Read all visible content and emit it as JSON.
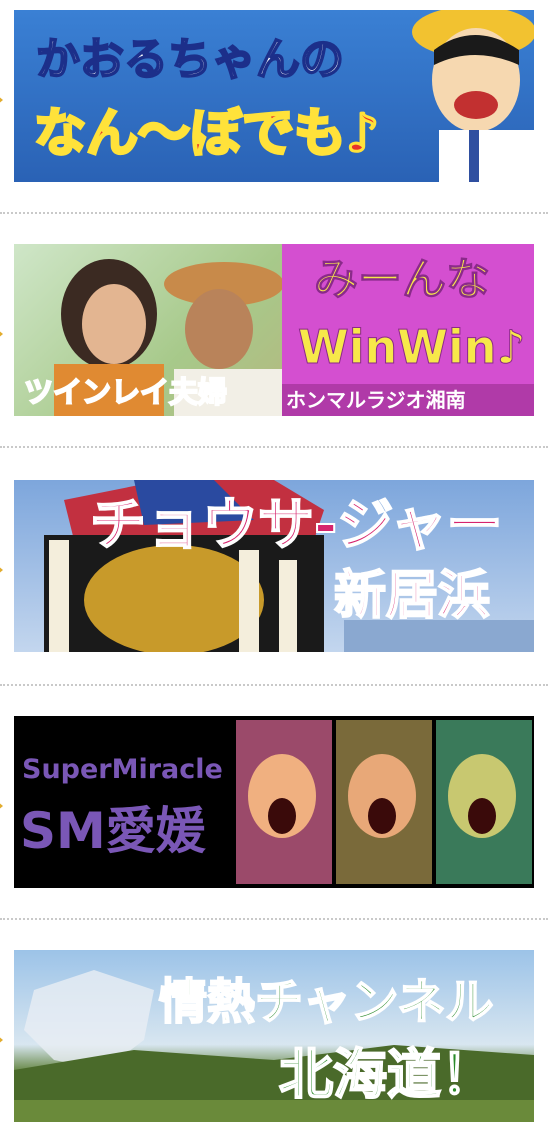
{
  "banners": [
    {
      "lines": [
        "かおるちゃんの",
        "なん〜ぼでも♪"
      ]
    },
    {
      "lines": [
        "みーんな",
        "WinWin♪",
        "ホンマルラジオ湘南",
        "ツインレイ夫婦"
      ]
    },
    {
      "lines": [
        "チョウサ-ジャー",
        "新居浜"
      ]
    },
    {
      "lines": [
        "SuperMiracle",
        "SM愛媛"
      ]
    },
    {
      "lines": [
        "情熱チャンネル",
        "北海道！"
      ]
    }
  ],
  "colors": {
    "arrow": "#e2ad2e",
    "separator": "#c9c9c9",
    "banner1_bg": "#2f6fc2",
    "banner1_title": "#ffffff",
    "banner1_subtitle": "#e8332a",
    "banner2_panel": "#d44fd0",
    "banner2_title": "#f7e84a",
    "banner3_text": "#d6246e",
    "banner4_bg": "#000000",
    "banner4_text": "#7a57b6",
    "banner5_text": "#2a8a2a"
  }
}
